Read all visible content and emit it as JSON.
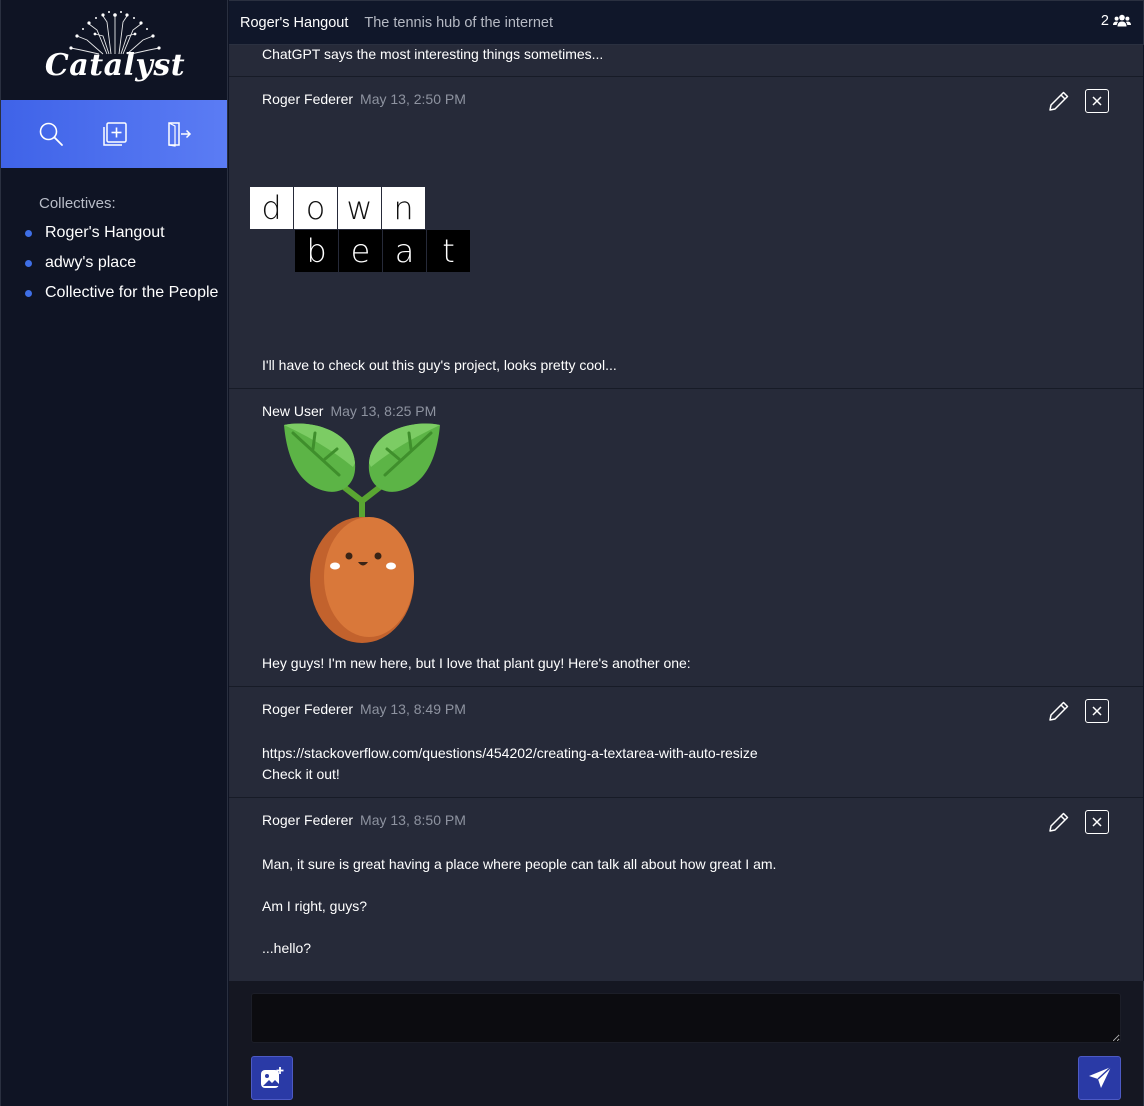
{
  "app": {
    "logo_text": "Catalyst"
  },
  "sidebar": {
    "tools": [
      {
        "icon": "search-icon"
      },
      {
        "icon": "add-collective-icon"
      },
      {
        "icon": "logout-icon"
      }
    ],
    "collectives_label": "Collectives:",
    "collectives": [
      {
        "name": "Roger's Hangout"
      },
      {
        "name": "adwy's place"
      },
      {
        "name": "Collective for the People"
      }
    ]
  },
  "header": {
    "name": "Roger's Hangout",
    "description": "The tennis hub of the internet",
    "member_count": "2",
    "member_icon": "users-icon"
  },
  "messages": [
    {
      "text": "ChatGPT says the most interesting things sometimes..."
    },
    {
      "author": "Roger Federer",
      "time": "May 13, 2:50 PM",
      "image": {
        "type": "downbeat-logo",
        "top_letters": [
          "d",
          "o",
          "w",
          "n"
        ],
        "bottom_letters": [
          "b",
          "e",
          "a",
          "t"
        ]
      },
      "text": "I'll have to check out this guy's project, looks pretty cool..."
    },
    {
      "author": "New User",
      "time": "May 13, 8:25 PM",
      "image": {
        "type": "plant-seed-sticker"
      },
      "text": "Hey guys! I'm new here, but I love that plant guy! Here's another one:"
    },
    {
      "author": "Roger Federer",
      "time": "May 13, 8:49 PM",
      "text": "https://stackoverflow.com/questions/454202/creating-a-textarea-with-auto-resize\nCheck it out!"
    },
    {
      "author": "Roger Federer",
      "time": "May 13, 8:50 PM",
      "text": "Man, it sure is great having a place where people can talk all about how great I am.\n\nAm I right, guys?\n\n...hello?"
    }
  ],
  "composer": {
    "message_value": "",
    "image_button_icon": "add-image-icon",
    "send_button_icon": "send-icon"
  },
  "colors": {
    "sidebar_bg": "#0f1424",
    "toolbar_gradient_start": "#3f63e8",
    "toolbar_gradient_end": "#5b7cf4",
    "feed_bg": "#262a39",
    "collective_dot": "#3f6fe6",
    "button_bg": "#2a3aa6"
  }
}
